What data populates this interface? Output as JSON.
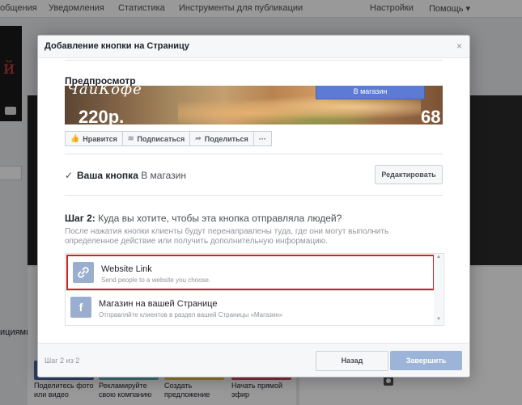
{
  "topnav": {
    "items": [
      "общения",
      "Уведомления",
      "Статистика",
      "Инструменты для публикации"
    ],
    "settings": "Настройки",
    "help": "Помощь ▾"
  },
  "background": {
    "left_text": "ициями",
    "cards": [
      "Поделитесь фото или видео",
      "Рекламируйте свою компанию",
      "Создать предложение",
      "Начать прямой эфир"
    ]
  },
  "modal": {
    "title": "Добавление кнопки на Страницу",
    "close": "×",
    "preview": {
      "label": "Предпросмотр",
      "cover_text": "ЧайКофе",
      "price": "220р.",
      "number": "68",
      "cta_button": "В магазин",
      "actions": [
        {
          "icon": "👍",
          "label": "Нравится"
        },
        {
          "icon": "≋",
          "label": "Подписаться"
        },
        {
          "icon": "➦",
          "label": "Поделиться"
        },
        {
          "icon": "",
          "label": "···"
        }
      ]
    },
    "your_button": {
      "label": "Ваша кнопка",
      "value": "В магазин",
      "edit": "Редактировать"
    },
    "step": {
      "title_bold": "Шаг 2:",
      "title_rest": "Куда вы хотите, чтобы эта кнопка отправляла людей?",
      "description": "После нажатия кнопки клиенты будут перенаправлены туда, где они могут выполнить определенное действие или получить дополнительную информацию."
    },
    "options": [
      {
        "icon": "link-icon",
        "title": "Website Link",
        "subtitle": "Send people to a website you choose."
      },
      {
        "icon": "facebook-icon",
        "title": "Магазин на вашей Странице",
        "subtitle": "Отправляйте клиентов в раздел вашей Страницы «Магазин»"
      }
    ],
    "footer": {
      "counter": "Шаг 2 из 2",
      "back": "Назад",
      "finish": "Завершить"
    }
  },
  "colors": {
    "brand": "#4267b2",
    "selected_border": "#d02323",
    "finish_disabled": "#9cb4d8"
  }
}
